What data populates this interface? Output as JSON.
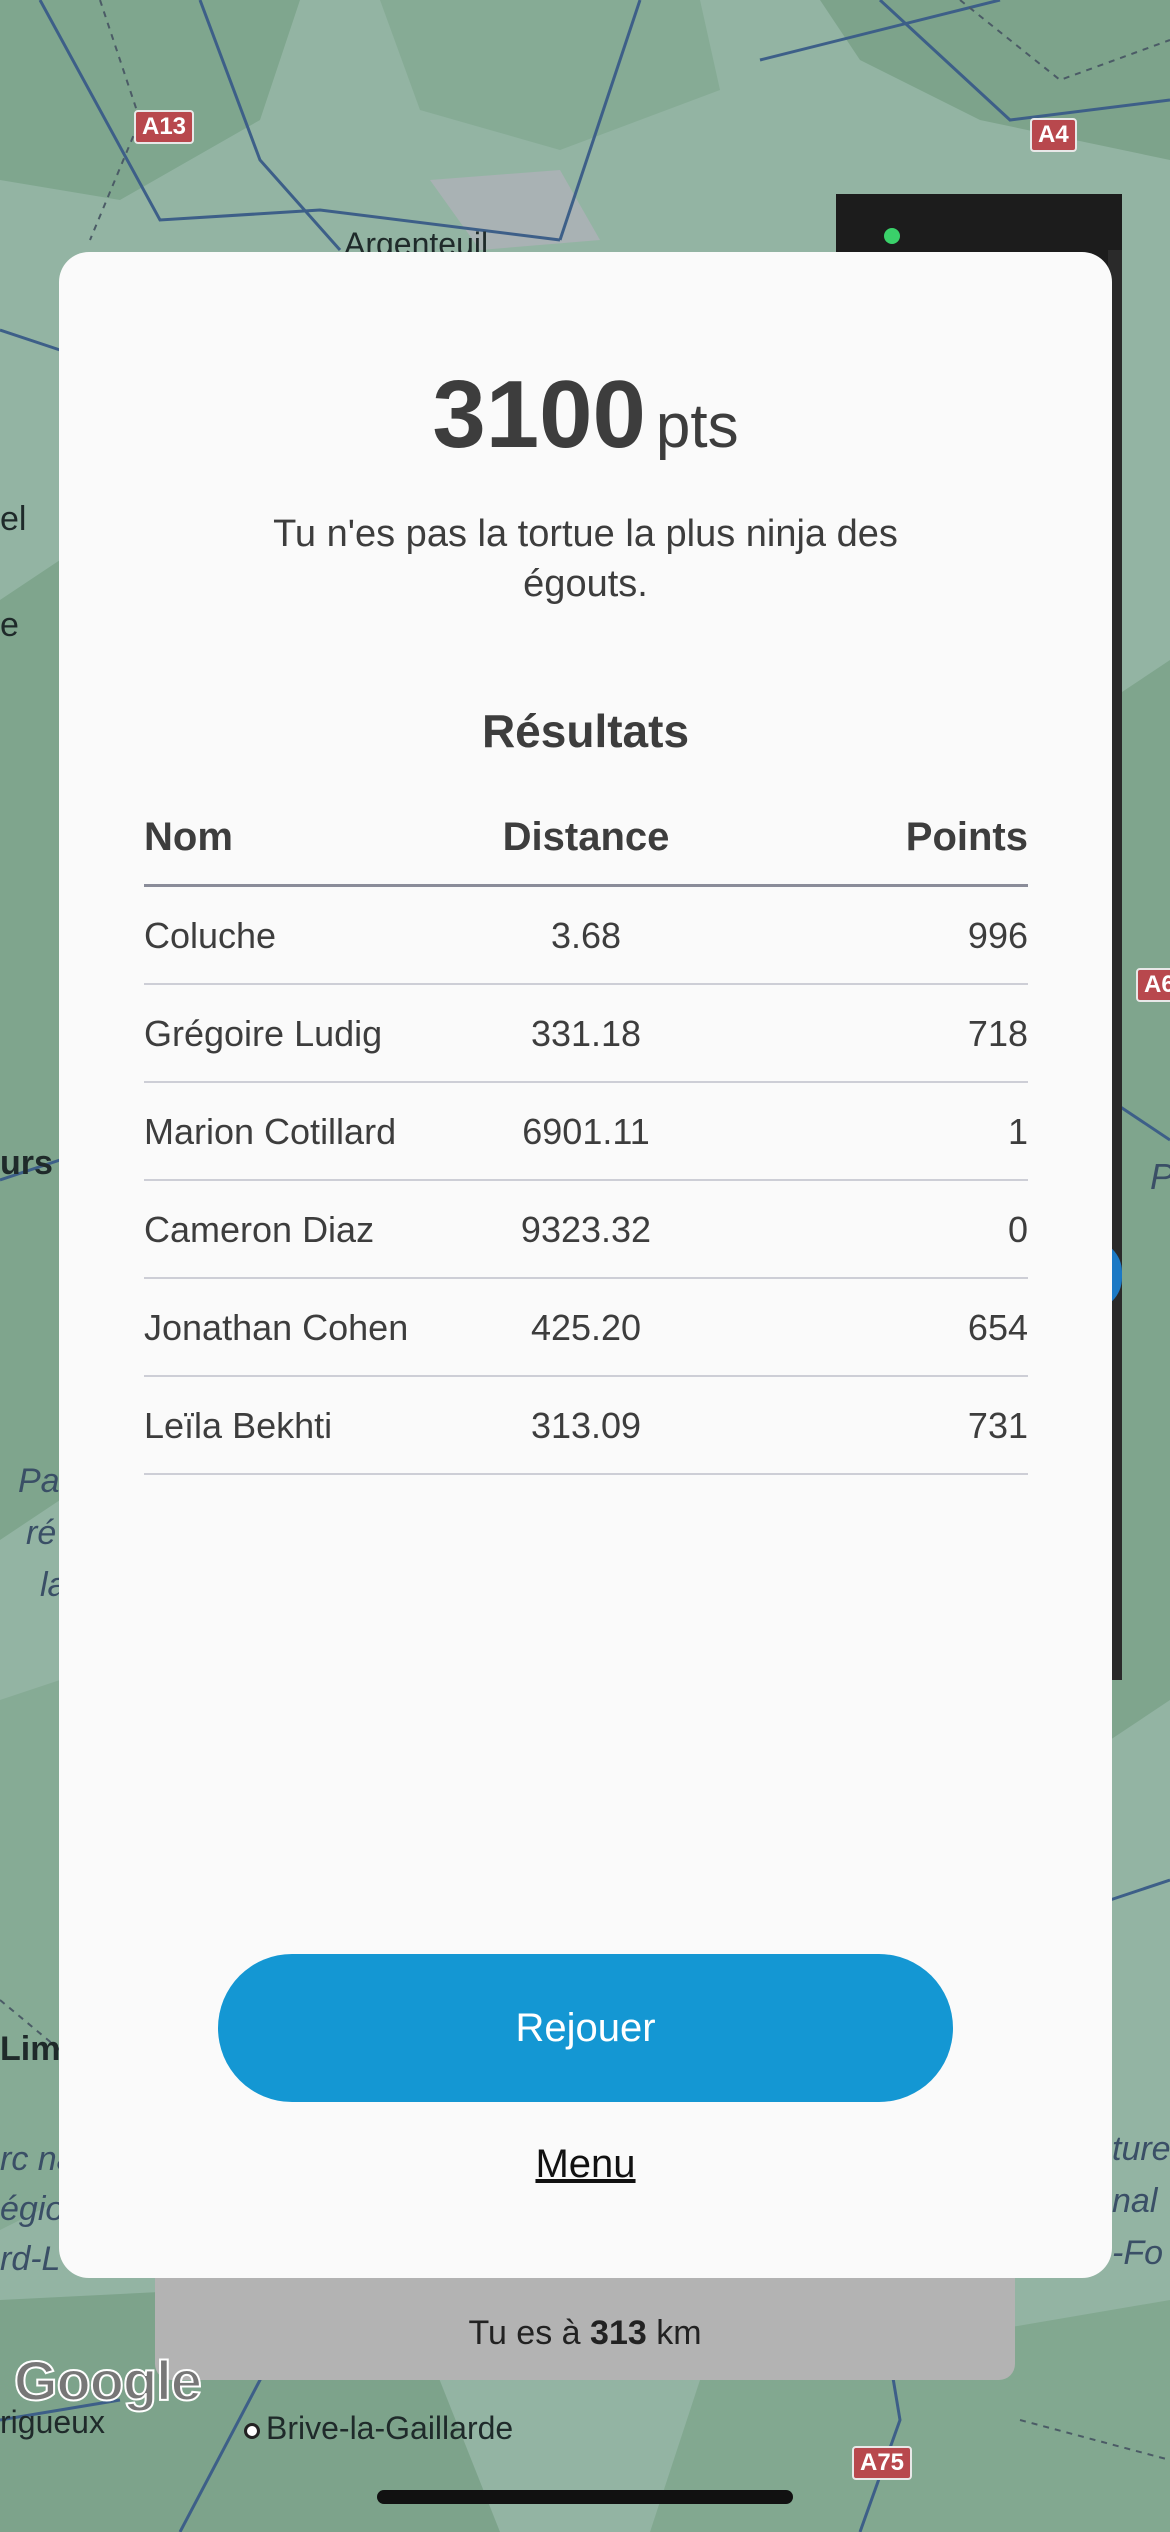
{
  "map": {
    "labels": {
      "argenteuil": "Argenteuil",
      "brive": "Brive-la-Gaillarde",
      "perigueux": "rigueux",
      "limoges": "Limo",
      "left_el": "el",
      "left_e": "e",
      "left_urs": "urs",
      "left_pa": "Pa",
      "left_re": "ré",
      "left_la": "la",
      "left_rc": "rc na",
      "left_egi": "égio",
      "left_rdl": "rd-L",
      "right_p": "P",
      "right_ture": "ture",
      "right_nal": "nal",
      "right_fo": "-Fo"
    },
    "road_badges": {
      "a13": "A13",
      "a4": "A4",
      "a6": "A6",
      "a75": "A75"
    },
    "attribution": "Google"
  },
  "result": {
    "score_value": "3100",
    "score_unit": "pts",
    "tagline": "Tu n'es pas la tortue la plus ninja des égouts.",
    "results_title": "Résultats",
    "columns": {
      "name": "Nom",
      "distance": "Distance",
      "points": "Points"
    },
    "rows": [
      {
        "name": "Coluche",
        "distance": "3.68",
        "points": "996"
      },
      {
        "name": "Grégoire Ludig",
        "distance": "331.18",
        "points": "718"
      },
      {
        "name": "Marion Cotillard",
        "distance": "6901.11",
        "points": "1"
      },
      {
        "name": "Cameron Diaz",
        "distance": "9323.32",
        "points": "0"
      },
      {
        "name": "Jonathan Cohen",
        "distance": "425.20",
        "points": "654"
      },
      {
        "name": "Leïla Bekhti",
        "distance": "313.09",
        "points": "731"
      }
    ],
    "replay_label": "Rejouer",
    "menu_label": "Menu"
  },
  "bottom_card": {
    "distance_prefix": "Tu es à",
    "distance_value": "313",
    "distance_unit": "km"
  },
  "colors": {
    "accent": "#1497d3",
    "modal_bg": "#fafafa",
    "text": "#3d3d3d"
  }
}
